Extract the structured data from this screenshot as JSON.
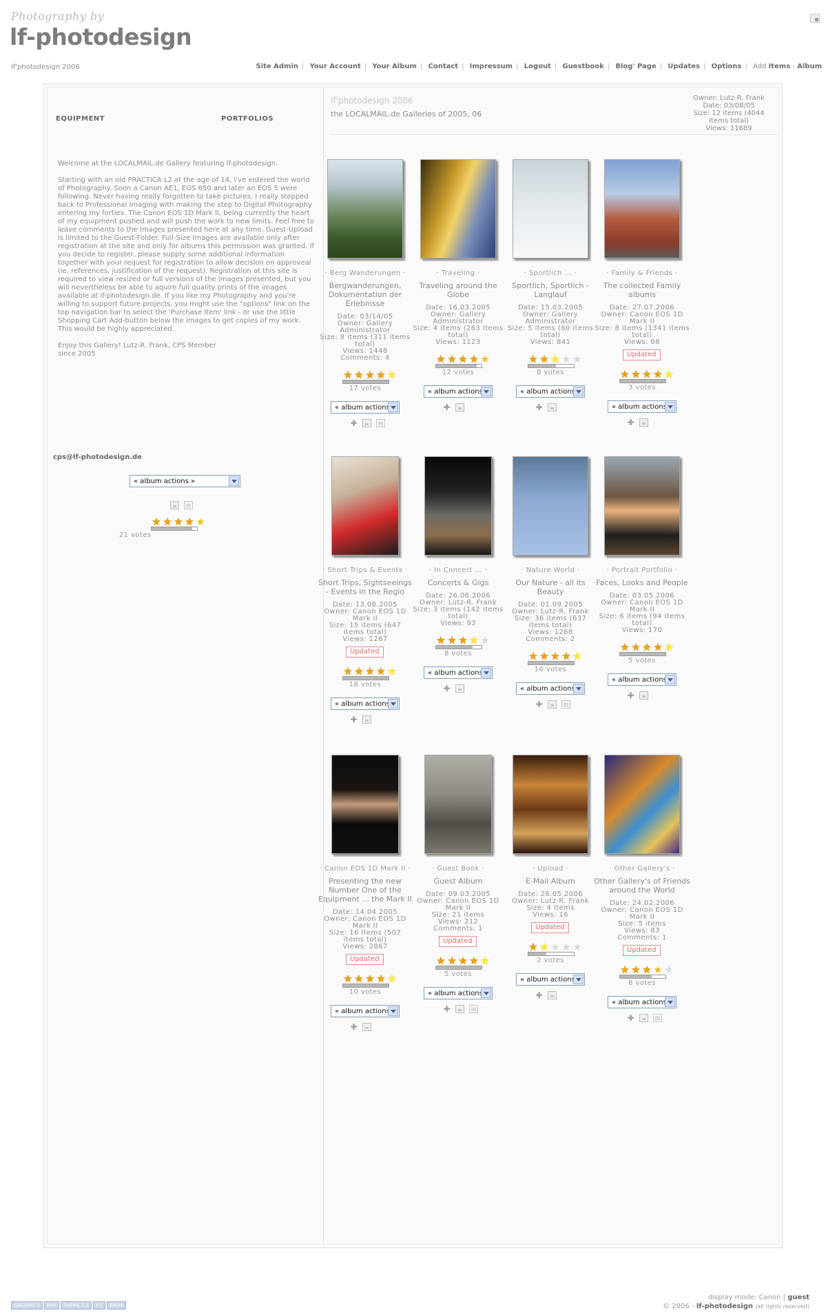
{
  "header": {
    "logo_small": "Photography by",
    "logo_big": "lf-photodesign",
    "site_sub": "lf'photodesign 2006"
  },
  "nav": [
    {
      "label": "Site Admin"
    },
    {
      "label": "Your Account"
    },
    {
      "label": "Your Album"
    },
    {
      "label": "Contact"
    },
    {
      "label": "Impressum"
    },
    {
      "label": "Logout"
    },
    {
      "label": "Guestbook"
    },
    {
      "label": "Blog' Page"
    },
    {
      "label": "Updates"
    },
    {
      "label": "Options"
    }
  ],
  "nav_tail": {
    "add": "Add",
    "items": "Items",
    "dash": " - ",
    "album": "Album"
  },
  "left": {
    "equipment": "EQUIPMENT",
    "portfolios": "PORTFOLIOS",
    "welcome_1": "Welcome at the LOCALMAIL.de Gallery featuring lf-photodesign.",
    "welcome_2": "Starting with an old PRACTICA L2 at the age of 14, I've entered the world of Photography. Soon a Canon AE1, EOS 650 and later an EOS 5 were following. Never having really forgotten to take pictures, I really stepped back to Professional Imaging with making the step to Digital Photography entering my forties. The Canon EOS 1D Mark II, being currently the heart of my equipment pushed and will push the work to new limits. Feel free to leave comments to the Images presented here at any time. Guest-Upload is limited to the Guest-Folder. Full-Size Images are available only after registration at the site and only for albums this permission was granted. If you decide to register, please supply some additional information together with your request for registration to allow decision on approveal (ie. references, justification of the request). Registration at this site is required to view resized or full versions of the images presented, but you will nevertheless be able to aquire full quality prints of the images available at lf-photodesign.de. If you like my Photography and you're willing to support future projects, you might use the \"options\" link on the top navigation bar to select the 'Purchase Item' link - or use the little Shopping Cart Add-button below the images to get copies of my work. This would be highly appreciated.",
    "welcome_3": "Enjoy this Gallery! Lutz-R. Frank, CPS Member since 2005",
    "email": "cps@lf-photodesign.de",
    "album_actions": "« album actions »",
    "rating": 4.5,
    "votes": "21 votes"
  },
  "right": {
    "title": "lf'photodesign 2006",
    "subtitle": "the LOCALMAIL.de Galleries of 2005, 06",
    "info": [
      "Owner: Lutz-R. Frank",
      "Date: 03/08/05",
      "Size: 12 items (4044",
      "items total)",
      "Views: 11689"
    ]
  },
  "albums": [
    {
      "cat": "· Berg Wanderungen ·",
      "desc": [
        "Bergwanderungen,",
        "Dokumentation der",
        "Erlebnisse"
      ],
      "meta": [
        "Date: 03/14/05",
        "Owner: Gallery",
        "Administrator",
        "Size: 8 items (311 items",
        "total)",
        "Views: 1448",
        "Comments: 4"
      ],
      "updated": "",
      "rating": 5,
      "votes": "17 votes",
      "actions": "« album actions »",
      "thumb": "mountain",
      "doc": true
    },
    {
      "cat": "· Traveling ·",
      "desc": [
        "Traveling around the",
        "Globe"
      ],
      "meta": [
        "Date: 16.03.2005",
        "Owner: Gallery",
        "Administrator",
        "Size: 4 items (263 items",
        "total)",
        "Views: 1123"
      ],
      "updated": "",
      "rating": 4.5,
      "votes": "12 votes",
      "actions": "« album actions »",
      "thumb": "pagoda",
      "doc": false
    },
    {
      "cat": "· Sportlich ... ·",
      "desc": [
        "Sportlich, Sportlich -",
        "Langlauf"
      ],
      "meta": [
        "Date: 15.03.2005",
        "Owner: Gallery",
        "Administrator",
        "Size: 5 items (60 items",
        "total)",
        "Views: 841"
      ],
      "updated": "",
      "rating": 3,
      "votes": "8 votes",
      "actions": "« album actions »",
      "thumb": "snow",
      "doc": false
    },
    {
      "cat": "· Family & Friends ·",
      "desc": [
        "The collected Family",
        "albums"
      ],
      "meta": [
        "Date: 27.07.2006",
        "Owner: Canon EOS 1D",
        "Mark II",
        "Size: 8 items (1341 items",
        "total)",
        "Views: 68"
      ],
      "updated": "Updated",
      "rating": 5,
      "votes": "3 votes",
      "actions": "« album actions »",
      "thumb": "church",
      "doc": false
    },
    {
      "cat": "· Short Trips & Events ·",
      "desc": [
        "Short Trips, Sightseeings",
        "- Events in the Regio"
      ],
      "meta": [
        "Date: 13.08.2005",
        "Owner: Canon EOS 1D",
        "Mark II",
        "Size: 15 items (647",
        "items total)",
        "Views: 1267"
      ],
      "updated": "Updated",
      "rating": 5,
      "votes": "18 votes",
      "actions": "« album actions »",
      "thumb": "fans",
      "doc": false
    },
    {
      "cat": "· In Concert ... ·",
      "desc": [
        "Concerts & Gigs"
      ],
      "meta": [
        "Date: 26.06.2006",
        "Owner: Lutz-R. Frank",
        "Size: 3 items (142 items",
        "total)",
        "Views: 93"
      ],
      "updated": "",
      "rating": 4,
      "votes": "8 votes",
      "actions": "« album actions »",
      "thumb": "concert",
      "doc": false
    },
    {
      "cat": "· Nature World ·",
      "desc": [
        "Our Nature - all its",
        "Beauty"
      ],
      "meta": [
        "Date: 01.09.2005",
        "Owner: Lutz-R. Frank",
        "Size: 36 items (637",
        "items total)",
        "Views: 1268",
        "Comments: 2"
      ],
      "updated": "",
      "rating": 5,
      "votes": "16 votes",
      "actions": "« album actions »",
      "thumb": "duck",
      "doc": true
    },
    {
      "cat": "· Portrait Portfolio ·",
      "desc": [
        "Faces, Looks and People"
      ],
      "meta": [
        "Date: 03.05.2006",
        "Owner: Canon EOS 1D",
        "Mark II",
        "Size: 6 items (94 items",
        "total)",
        "Views: 170"
      ],
      "updated": "",
      "rating": 5,
      "votes": "5 votes",
      "actions": "« album actions »",
      "thumb": "portrait",
      "doc": false
    },
    {
      "cat": "· Canon EOS 1D Mark II ·",
      "desc": [
        "Presenting the new",
        "Number One of the",
        "Equipment ... the Mark II"
      ],
      "meta": [
        "Date: 14.04.2005",
        "Owner: Canon EOS 1D",
        "Mark II",
        "Size: 16 items (507",
        "items total)",
        "Views: 2867"
      ],
      "updated": "Updated",
      "rating": 5,
      "votes": "10 votes",
      "actions": "« album actions »",
      "thumb": "model",
      "doc": false
    },
    {
      "cat": "· Guest Book ·",
      "desc": [
        "Guest Album"
      ],
      "meta": [
        "Date: 09.03.2005",
        "Owner: Canon EOS 1D",
        "Mark II",
        "Size: 21 items",
        "Views: 212",
        "Comments: 1"
      ],
      "updated": "Updated",
      "rating": 5,
      "votes": "5 votes",
      "actions": "« album actions »",
      "thumb": "elephant",
      "doc": true
    },
    {
      "cat": "· Upload ·",
      "desc": [
        "E-Mail Album"
      ],
      "meta": [
        "Date: 26.05.2006",
        "Owner: Lutz-R. Frank",
        "Size: 4 items",
        "Views: 16"
      ],
      "updated": "Updated",
      "rating": 2,
      "votes": "2 votes",
      "actions": "« album actions »",
      "thumb": "pirates",
      "doc": false
    },
    {
      "cat": "· Other Gallery's ·",
      "desc": [
        "Other Gallery's of Friends",
        "around the World"
      ],
      "meta": [
        "Date: 24.02.2006",
        "Owner: Canon EOS 1D",
        "Mark II",
        "Size: 5 items",
        "Views: 83",
        "Comments: 1"
      ],
      "updated": "Updated",
      "rating": 3.5,
      "votes": "8 votes",
      "actions": "« album actions »",
      "thumb": "hands",
      "doc": true
    }
  ],
  "footer": {
    "display_mode": "display mode:",
    "mode": "Canon",
    "sep": "|",
    "user": "guest",
    "copyright": "© 2006 -",
    "brand": "lf-photodesign",
    "rights": "(all rights reserved)",
    "badges": [
      "GALLERY 2",
      "PHP",
      "THEME 1.1",
      "FQ",
      "ZHOK"
    ]
  }
}
